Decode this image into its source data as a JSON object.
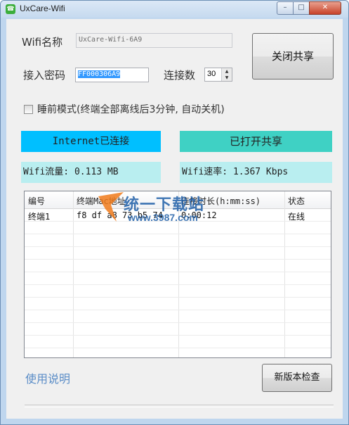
{
  "window": {
    "title": "UxCare-Wifi",
    "icon_glyph": "☎",
    "controls": {
      "minimize": "–",
      "maximize": "□",
      "close": "✕"
    }
  },
  "form": {
    "wifi_name_label": "Wifi名称",
    "wifi_name_value": "UxCare-Wifi-6A9",
    "password_label": "接入密码",
    "password_value": "FF000306A9",
    "connections_label": "连接数",
    "connections_value": "30",
    "sleep_mode_label": "睡前模式(终端全部离线后3分钟, 自动关机)",
    "sleep_mode_checked": false
  },
  "buttons": {
    "toggle_share": "关闭共享",
    "check_update": "新版本检查"
  },
  "status": {
    "internet": "Internet已连接",
    "share": "已打开共享",
    "traffic": "Wifi流量: 0.113 MB",
    "speed": "Wifi速率: 1.367 Kbps"
  },
  "colors": {
    "internet_panel": "#00bfff",
    "share_panel": "#3fd1c4",
    "info_panel": "#b9eef0",
    "help_link": "#5b8dc7"
  },
  "table": {
    "columns": [
      "编号",
      "终端Mac地址",
      "连接时长(h:mm:ss)",
      "状态"
    ],
    "rows": [
      [
        "终端1",
        "f8 df a8 73 b5 74",
        "0:00:12",
        "在线"
      ]
    ]
  },
  "watermark": {
    "text": "统一下载站",
    "url": "www.3987.com"
  },
  "help_link": "使用说明"
}
